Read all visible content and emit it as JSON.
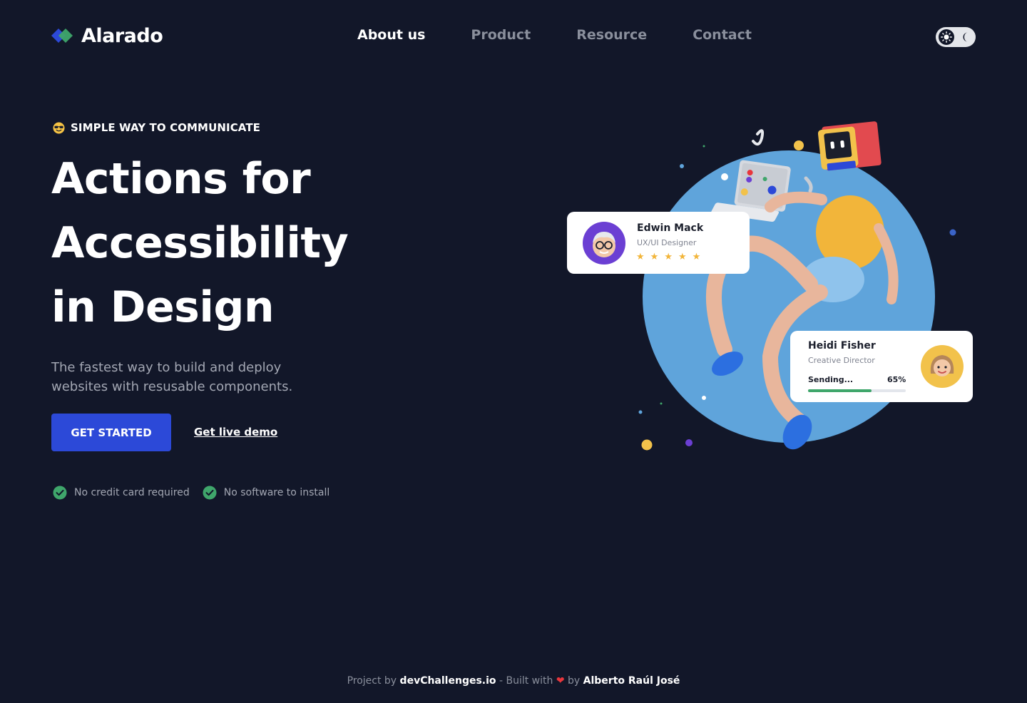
{
  "brand": {
    "name": "Alarado",
    "logo_icon": "diamond-logo-icon"
  },
  "nav": {
    "items": [
      {
        "label": "About us",
        "active": true
      },
      {
        "label": "Product",
        "active": false
      },
      {
        "label": "Resource",
        "active": false
      },
      {
        "label": "Contact",
        "active": false
      }
    ]
  },
  "theme_toggle": {
    "light_icon": "sun-icon",
    "dark_icon": "moon-icon"
  },
  "hero": {
    "tagline_emoji": "sunglasses-emoji-icon",
    "tagline": "SIMPLE WAY TO COMMUNICATE",
    "headline": [
      "Actions for",
      "Accessibility",
      "in Design"
    ],
    "subtext": "The fastest way to build and deploy websites with resusable components.",
    "primary_button": "GET STARTED",
    "secondary_link": "Get live demo",
    "checks": [
      "No credit card required",
      "No software to install"
    ]
  },
  "cards": {
    "edwin": {
      "name": "Edwin Mack",
      "role": "UX/UI Designer",
      "rating": 5
    },
    "heidi": {
      "name": "Heidi Fisher",
      "role": "Creative Director",
      "status": "Sending...",
      "progress_label": "65%",
      "progress": 0.65
    }
  },
  "footer": {
    "prefix": "Project by",
    "site": "devChallenges.io",
    "middle": "- Built with",
    "by": "by",
    "author": "Alberto Raúl José"
  },
  "colors": {
    "background": "#121729",
    "primary": "#2c49d8",
    "circle": "#5fa4db",
    "check": "#3fa66b",
    "star": "#f2b53a"
  }
}
